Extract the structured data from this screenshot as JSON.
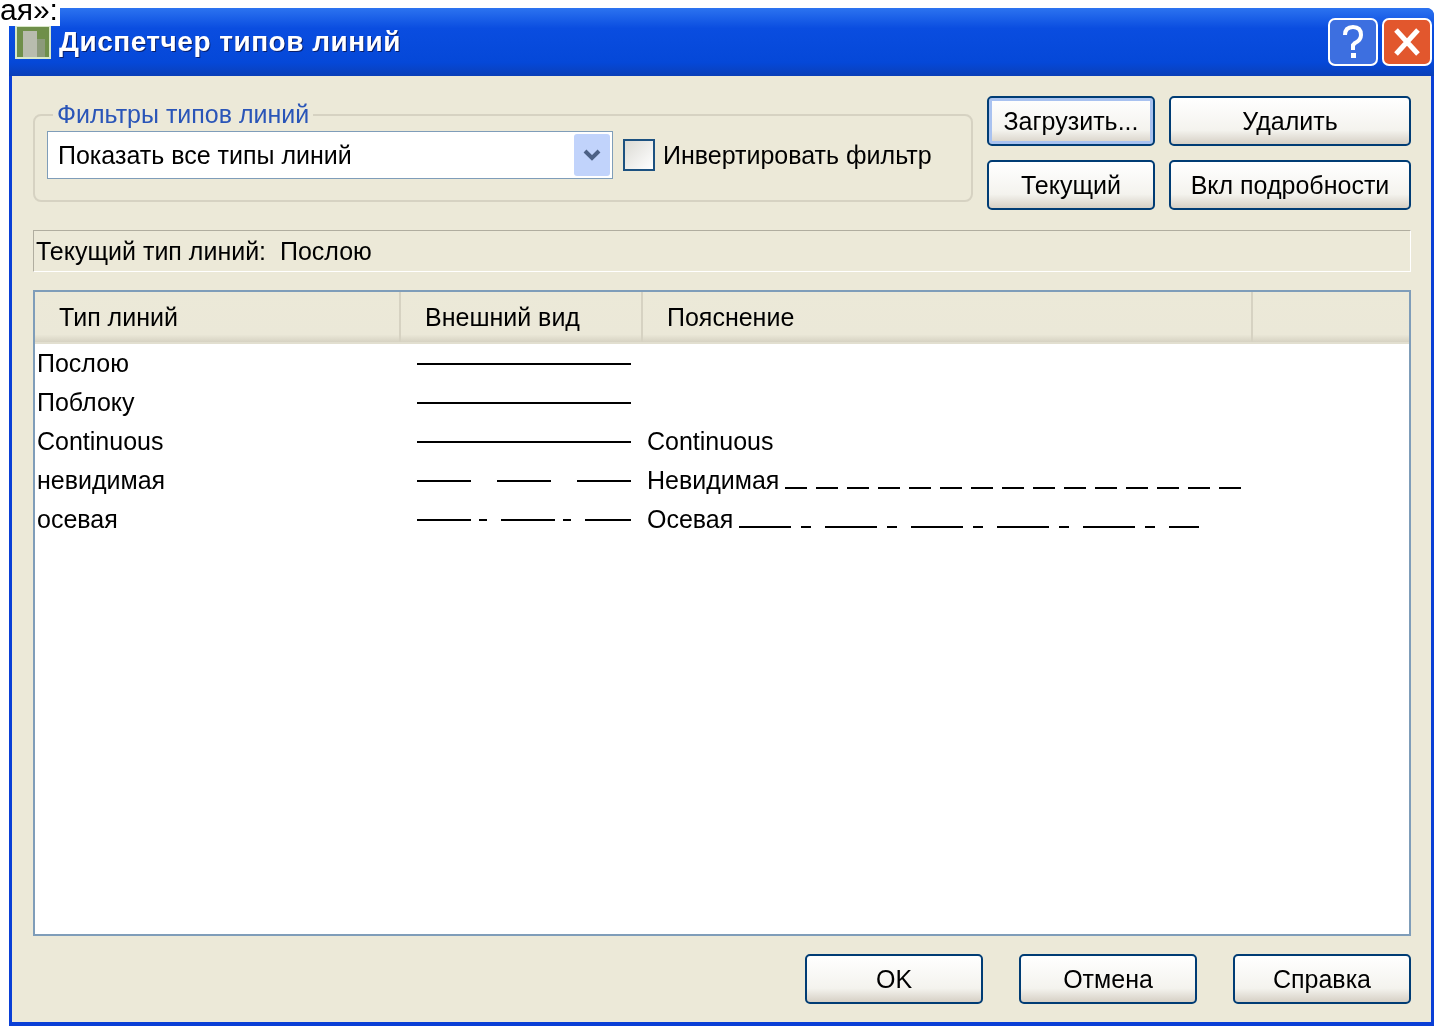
{
  "caption_fragment": "ая»:",
  "window": {
    "title": "Диспетчер типов линий"
  },
  "filter_group": {
    "label": "Фильтры типов линий",
    "dropdown": {
      "value": "Показать все типы линий"
    },
    "invert_checkbox": {
      "label": "Инвертировать фильтр",
      "checked": false
    }
  },
  "side_buttons": [
    {
      "label": "Загрузить...",
      "focused": true
    },
    {
      "label": "Удалить",
      "focused": false
    },
    {
      "label": "Текущий",
      "focused": false
    },
    {
      "label": "Вкл подробности",
      "focused": false
    }
  ],
  "current_linetype": {
    "label": "Текущий тип линий:",
    "value": "Послою"
  },
  "table": {
    "columns": [
      "Тип линий",
      "Внешний вид",
      "Пояснение"
    ],
    "rows": [
      {
        "name": "Послою",
        "kind": "solid"
      },
      {
        "name": "Поблоку",
        "kind": "solid"
      },
      {
        "name": "Continuous",
        "kind": "solid",
        "description": "Continuous"
      },
      {
        "name": "невидимая",
        "kind": "dashed",
        "description": "Невидимая"
      },
      {
        "name": "осевая",
        "kind": "dashdot",
        "description": "Осевая"
      }
    ]
  },
  "footer_buttons": [
    "OK",
    "Отмена",
    "Справка"
  ]
}
